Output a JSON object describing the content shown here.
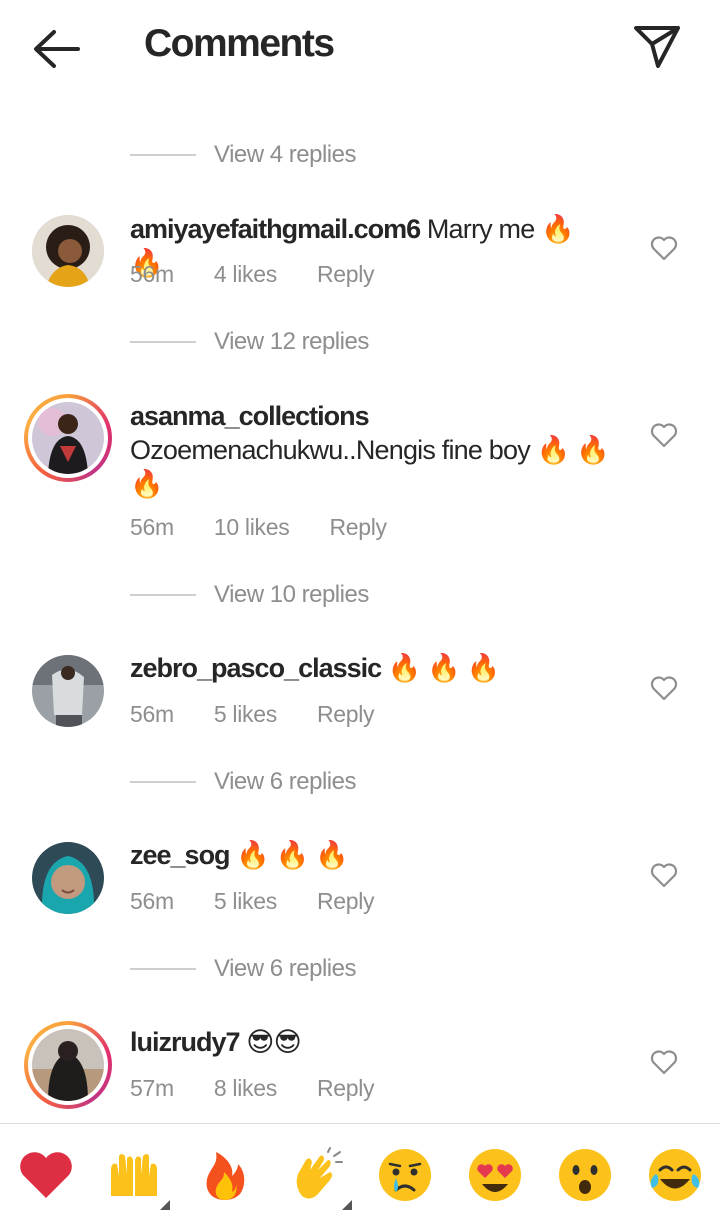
{
  "header": {
    "title": "Comments"
  },
  "comments": [
    {
      "username": "amiyayefaithgmail.com6",
      "text": "Marry me",
      "emojis": "fire fire",
      "time": "56m",
      "likes": "4 likes",
      "reply": "Reply"
    },
    {
      "username": "asanma_collections",
      "text": "Ozoemenachukwu..Nengis fine boy",
      "emojis": "fire fire fire",
      "time": "56m",
      "likes": "10 likes",
      "reply": "Reply"
    },
    {
      "username": "zebro_pasco_classic",
      "text": "",
      "emojis": "fire fire fire",
      "time": "56m",
      "likes": "5 likes",
      "reply": "Reply"
    },
    {
      "username": "zee_sog",
      "text": "",
      "emojis": "fire fire fire",
      "time": "56m",
      "likes": "5 likes",
      "reply": "Reply"
    },
    {
      "username": "luizrudy7",
      "text": "",
      "emojis": "sunglasses sunglasses",
      "time": "57m",
      "likes": "8 likes",
      "reply": "Reply"
    }
  ],
  "view_replies": [
    "View 4 replies",
    "View 12 replies",
    "View 10 replies",
    "View 6 replies",
    "View 6 replies"
  ],
  "emoji_bar": [
    "red-heart",
    "raising-hands",
    "fire",
    "clapping-hands",
    "crying-face",
    "heart-eyes",
    "astonished-face",
    "tears-of-joy"
  ]
}
